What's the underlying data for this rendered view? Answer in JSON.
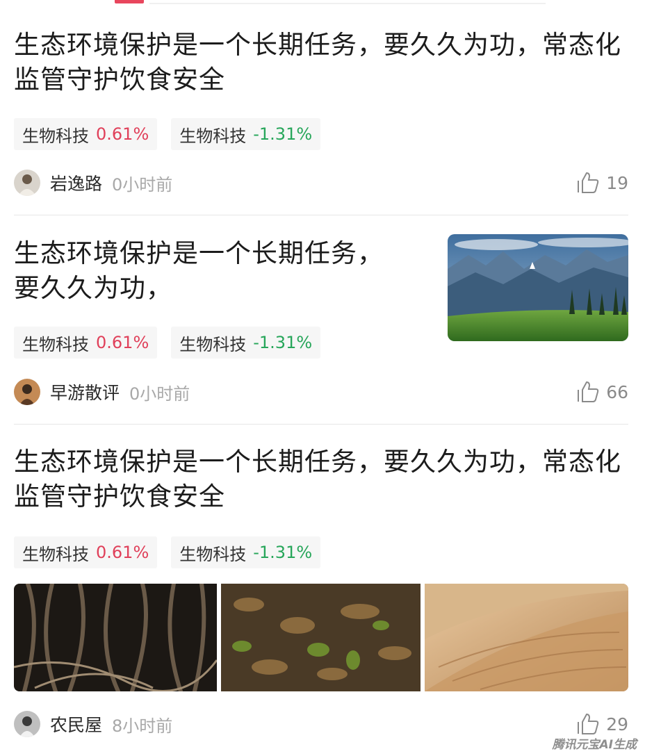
{
  "feed": [
    {
      "title": "生态环境保护是一个长期任务，要久久为功，常态化监管守护饮食安全",
      "tags": [
        {
          "name": "生物科技",
          "change": "0.61%"
        },
        {
          "name": "生物科技",
          "change": "-1.31%"
        }
      ],
      "author": "岩逸路",
      "time": "0小时前",
      "likes": "19"
    },
    {
      "title": "生态环境保护是一个长期任务，要久久为功，",
      "tags": [
        {
          "name": "生物科技",
          "change": "0.61%"
        },
        {
          "name": "生物科技",
          "change": "-1.31%"
        }
      ],
      "author": "早游散评",
      "time": "0小时前",
      "likes": "66"
    },
    {
      "title": "生态环境保护是一个长期任务，要久久为功，常态化监管守护饮食安全",
      "tags": [
        {
          "name": "生物科技",
          "change": "0.61%"
        },
        {
          "name": "生物科技",
          "change": "-1.31%"
        }
      ],
      "author": "农民屋",
      "time": "8小时前",
      "likes": "29"
    }
  ],
  "watermark": "腾讯元宝AI生成",
  "colors": {
    "accent": "#e8465d",
    "up": "#e0405a",
    "down": "#27a65a"
  }
}
